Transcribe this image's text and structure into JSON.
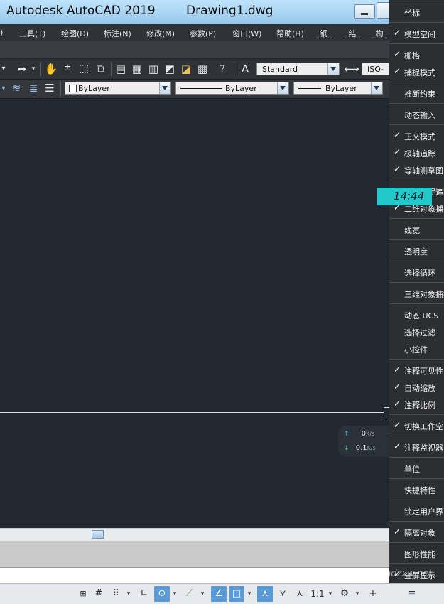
{
  "window": {
    "app_title": "Autodesk AutoCAD 2019",
    "file_title": "Drawing1.dwg"
  },
  "menubar": {
    "items": [
      ")",
      "工具(T)",
      "绘图(D)",
      "标注(N)",
      "修改(M)",
      "参数(P)",
      "窗口(W)",
      "帮助(H)",
      "_钢_",
      "_结_",
      "_构_"
    ]
  },
  "toolbar1": {
    "text_style": "Standard",
    "dim_style": "ISO-"
  },
  "toolbar2": {
    "color": "ByLayer",
    "linetype": "ByLayer",
    "lineweight": "ByLayer"
  },
  "network": {
    "upload": "0",
    "upload_unit": "K/s",
    "download": "0.1",
    "download_unit": "K/s"
  },
  "clock": "14:44",
  "context_menu": {
    "groups": [
      {
        "items": [
          {
            "label": "坐标",
            "checked": false
          }
        ]
      },
      {
        "items": [
          {
            "label": "模型空间",
            "checked": true
          }
        ]
      },
      {
        "items": [
          {
            "label": "栅格",
            "checked": true
          },
          {
            "label": "捕捉模式",
            "checked": true
          }
        ]
      },
      {
        "items": [
          {
            "label": "推断约束",
            "checked": false
          }
        ]
      },
      {
        "items": [
          {
            "label": "动态输入",
            "checked": false
          }
        ]
      },
      {
        "items": [
          {
            "label": "正交模式",
            "checked": true
          },
          {
            "label": "极轴追踪",
            "checked": true
          },
          {
            "label": "等轴测草图",
            "checked": true
          }
        ]
      },
      {
        "items": [
          {
            "label": "对象捕捉追踪",
            "checked": false
          },
          {
            "label": "二维对象捕捉",
            "checked": true
          }
        ]
      },
      {
        "items": [
          {
            "label": "线宽",
            "checked": false
          }
        ]
      },
      {
        "items": [
          {
            "label": "透明度",
            "checked": false
          }
        ]
      },
      {
        "items": [
          {
            "label": "选择循环",
            "checked": false
          }
        ]
      },
      {
        "items": [
          {
            "label": "三维对象捕捉",
            "checked": false
          }
        ]
      },
      {
        "items": [
          {
            "label": "动态 UCS",
            "checked": false
          },
          {
            "label": "选择过滤",
            "checked": false
          },
          {
            "label": "小控件",
            "checked": false
          }
        ]
      },
      {
        "items": [
          {
            "label": "注释可见性",
            "checked": true
          },
          {
            "label": "自动缩放",
            "checked": true
          },
          {
            "label": "注释比例",
            "checked": true
          }
        ]
      },
      {
        "items": [
          {
            "label": "切换工作空间",
            "checked": true
          }
        ]
      },
      {
        "items": [
          {
            "label": "注释监视器",
            "checked": true
          }
        ]
      },
      {
        "items": [
          {
            "label": "单位",
            "checked": false
          }
        ]
      },
      {
        "items": [
          {
            "label": "快捷特性",
            "checked": false
          }
        ]
      },
      {
        "items": [
          {
            "label": "锁定用户界面",
            "checked": false
          }
        ]
      },
      {
        "items": [
          {
            "label": "隔离对象",
            "checked": true
          }
        ]
      },
      {
        "items": [
          {
            "label": "图形性能",
            "checked": false
          }
        ]
      },
      {
        "items": [
          {
            "label": "全屏显示",
            "checked": true
          }
        ]
      }
    ]
  },
  "statusbar": {
    "model_label": "1:1"
  },
  "watermark": "www.cadzxw.net"
}
